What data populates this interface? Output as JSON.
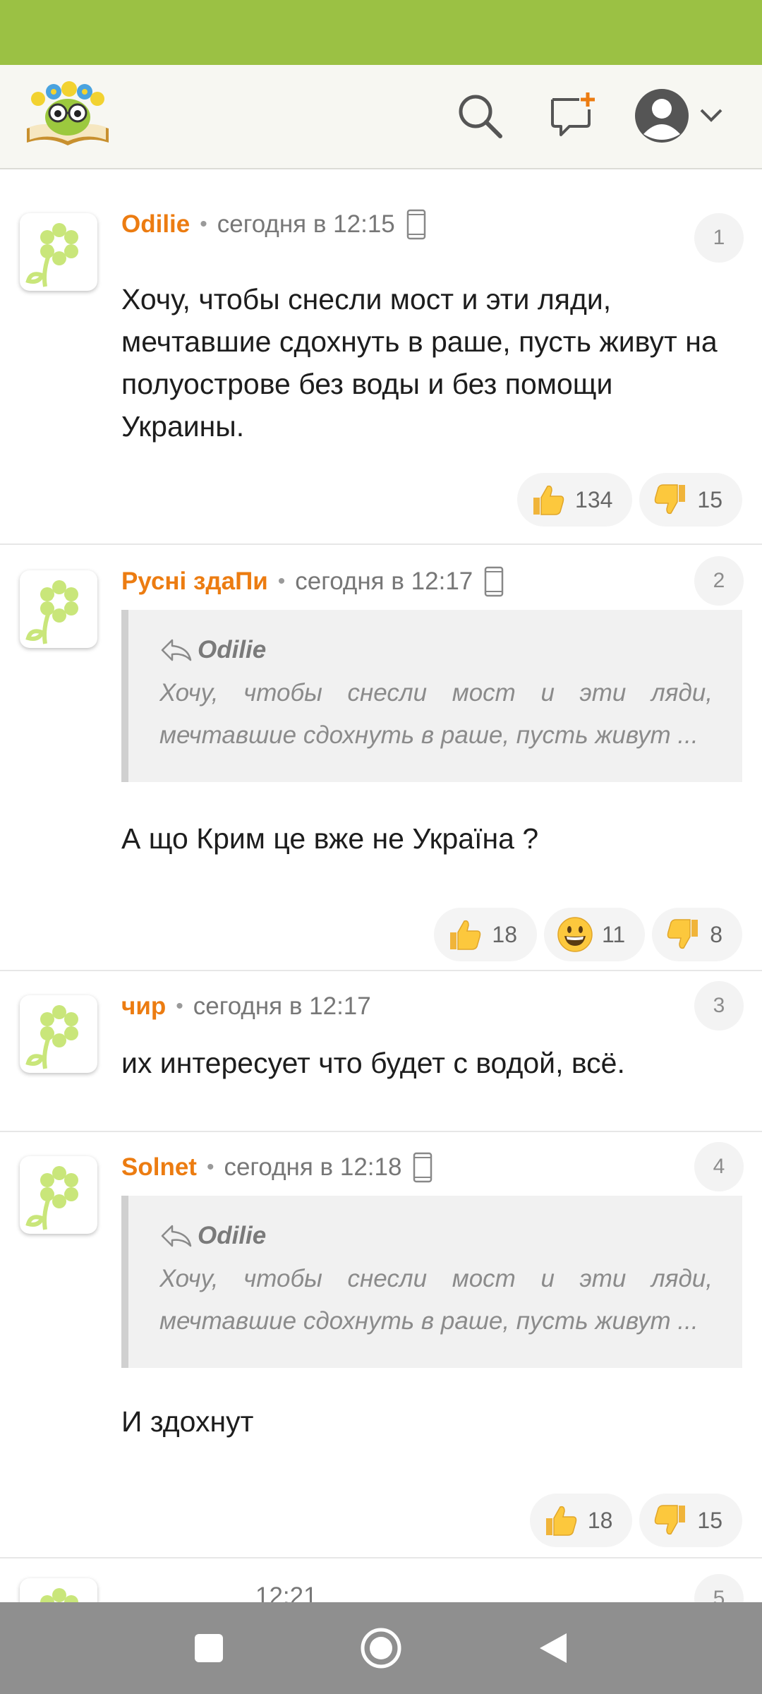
{
  "colors": {
    "status_bar": "#9bc144",
    "author": "#ec7c11",
    "header_bg": "#f7f7f2",
    "nav_bar": "#8f8f8f"
  },
  "header": {
    "logo": "site-logo",
    "icons": [
      "search-icon",
      "new-post-icon",
      "profile-avatar-icon",
      "chevron-down-icon"
    ]
  },
  "comments": [
    {
      "author": "Odilie",
      "time": "сегодня в 12:15",
      "device": "mobile-device-icon",
      "number": "1",
      "text": "Хочу, чтобы снесли мост и эти ляди, мечтавшие сдохнуть в раше, пусть живут на полуострове без воды и без помощи Украины.",
      "reactions": [
        {
          "icon": "thumbs-up-icon",
          "count": "134"
        },
        {
          "icon": "thumbs-down-icon",
          "count": "15"
        }
      ]
    },
    {
      "author": "Русні здаПи",
      "time": "сегодня в 12:17",
      "device": "mobile-device-icon",
      "number": "2",
      "quote": {
        "author": "Odilie",
        "text": "Хочу, чтобы снесли мост и эти ляди, мечтавшие сдохнуть в раше, пусть живут ..."
      },
      "text": "А що Крим це вже не Україна ?",
      "reactions": [
        {
          "icon": "thumbs-up-icon",
          "count": "18"
        },
        {
          "icon": "grinning-face-icon",
          "count": "11"
        },
        {
          "icon": "thumbs-down-icon",
          "count": "8"
        }
      ]
    },
    {
      "author": "чир",
      "time": "сегодня в 12:17",
      "number": "3",
      "text": "их интересует что будет с водой, всё."
    },
    {
      "author": "Solnet",
      "time": "сегодня в 12:18",
      "device": "mobile-device-icon",
      "number": "4",
      "quote": {
        "author": "Odilie",
        "text": "Хочу, чтобы снесли мост и эти ляди, мечтавшие сдохнуть в раше, пусть живут ..."
      },
      "text": "И здохнут",
      "reactions": [
        {
          "icon": "thumbs-up-icon",
          "count": "18"
        },
        {
          "icon": "thumbs-down-icon",
          "count": "15"
        }
      ]
    },
    {
      "author": "",
      "time": "12:21",
      "number": "5"
    }
  ],
  "nav": {
    "icons": [
      "recent-apps-icon",
      "home-icon",
      "back-icon"
    ]
  }
}
